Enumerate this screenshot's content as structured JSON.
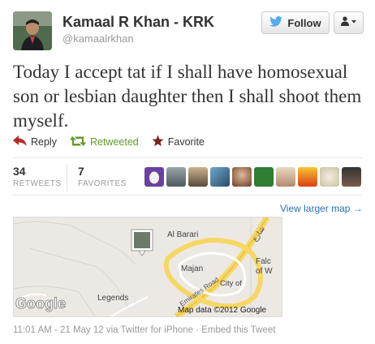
{
  "tweet": {
    "display_name": "Kamaal R Khan - KRK",
    "handle": "@kamaalrkhan",
    "text": "Today I accept tat if I shall have homosexual son or lesbian daughter then I shall shoot them myself.",
    "follow_label": "Follow",
    "actions": {
      "reply": "Reply",
      "retweeted": "Retweeted",
      "favorite": "Favorite"
    },
    "stats": {
      "retweets_count": "34",
      "retweets_label": "RETWEETS",
      "favorites_count": "7",
      "favorites_label": "FAVORITES"
    },
    "meta": "11:01 AM - 21 May 12 via Twitter for iPhone · Embed this Tweet"
  },
  "map": {
    "link_label": "View larger map →",
    "labels": {
      "al_barari": "Al Barari",
      "majan": "Majan",
      "legends": "Legends",
      "falc": "Falc",
      "of_w": "of W",
      "road": "Emirates Road",
      "city_of": "City of",
      "copyright": "Map data ©2012 Google",
      "brand": "Google",
      "arabic": "شارع"
    }
  },
  "colors": {
    "twitter_blue": "#55acee",
    "reply": "#b42a29",
    "retweeted": "#609928",
    "favorite": "#7c2525",
    "link": "#2a6fb5",
    "road_yellow": "#f6d764"
  },
  "icons": [
    "twitter-bird-icon",
    "user-menu-icon",
    "reply-icon",
    "retweet-icon",
    "favorite-star-icon",
    "map-pin-icon"
  ]
}
